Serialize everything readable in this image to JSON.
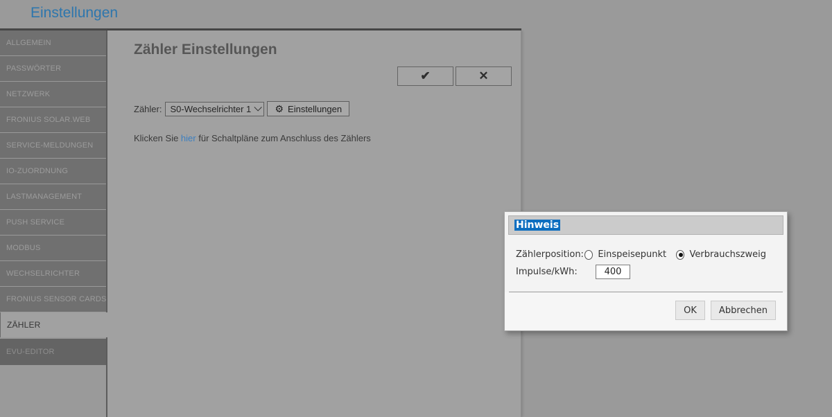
{
  "page": {
    "title": "Einstellungen"
  },
  "sidebar": {
    "items": [
      {
        "label": "ALLGEMEIN",
        "active": false
      },
      {
        "label": "PASSWÖRTER",
        "active": false
      },
      {
        "label": "NETZWERK",
        "active": false
      },
      {
        "label": "FRONIUS SOLAR.WEB",
        "active": false
      },
      {
        "label": "SERVICE-MELDUNGEN",
        "active": false
      },
      {
        "label": "IO-ZUORDNUNG",
        "active": false
      },
      {
        "label": "LASTMANAGEMENT",
        "active": false
      },
      {
        "label": "PUSH SERVICE",
        "active": false
      },
      {
        "label": "MODBUS",
        "active": false
      },
      {
        "label": "WECHSELRICHTER",
        "active": false
      },
      {
        "label": "FRONIUS SENSOR CARDS",
        "active": false
      },
      {
        "label": "ZÄHLER",
        "active": true
      },
      {
        "label": "EVU-EDITOR",
        "active": false
      }
    ]
  },
  "main": {
    "title": "Zähler Einstellungen",
    "meter_label": "Zähler:",
    "meter_select_value": "S0-Wechselrichter 1",
    "settings_button": "Einstellungen",
    "hint_text_before": "Klicken Sie ",
    "hint_link": "hier",
    "hint_text_after": " für Schaltpläne zum Anschluss des Zählers"
  },
  "icons": {
    "confirm": "✔",
    "cancel": "✕",
    "gear": "⚙"
  },
  "dialog": {
    "title": "Hinweis",
    "position_label": "Zählerposition:",
    "radios": [
      {
        "label": "Einspeisepunkt",
        "checked": false
      },
      {
        "label": "Verbrauchszweig",
        "checked": true
      }
    ],
    "impulse_label": "Impulse/kWh:",
    "impulse_value": "400",
    "ok_button": "OK",
    "cancel_button": "Abbrechen"
  },
  "colors": {
    "page_background": "#9a9a9a",
    "panel_background": "#a1a1a1",
    "sidebar_item": "#707070",
    "title_blue": "#2d76ad",
    "link_blue": "#3c7fc0",
    "selection_blue": "#0d6ec0"
  }
}
